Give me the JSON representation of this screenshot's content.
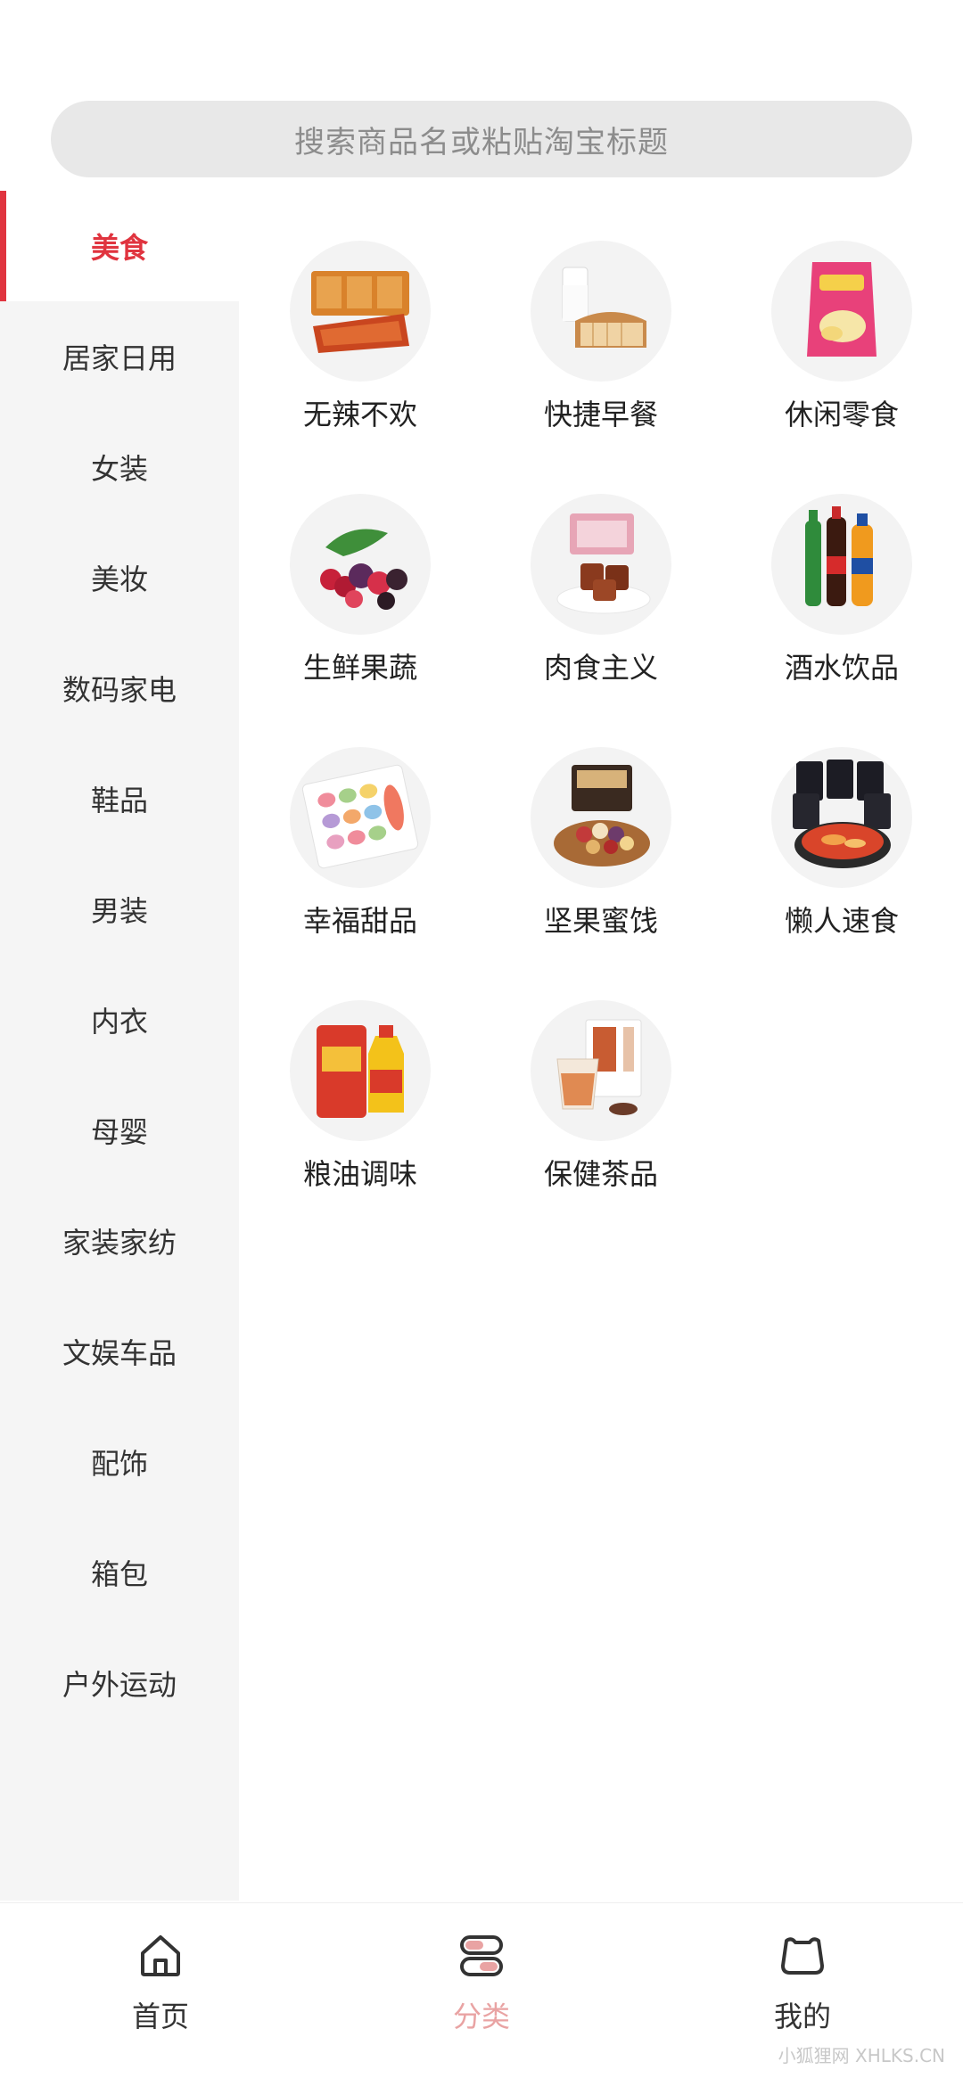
{
  "search": {
    "placeholder": "搜索商品名或粘贴淘宝标题"
  },
  "sidebar": {
    "items": [
      {
        "label": "美食",
        "active": true
      },
      {
        "label": "居家日用"
      },
      {
        "label": "女装"
      },
      {
        "label": "美妆"
      },
      {
        "label": "数码家电"
      },
      {
        "label": "鞋品"
      },
      {
        "label": "男装"
      },
      {
        "label": "内衣"
      },
      {
        "label": "母婴"
      },
      {
        "label": "家装家纺"
      },
      {
        "label": "文娱车品"
      },
      {
        "label": "配饰"
      },
      {
        "label": "箱包"
      },
      {
        "label": "户外运动"
      }
    ]
  },
  "subcategories": [
    {
      "label": "无辣不欢",
      "icon": "spicy-snack-icon"
    },
    {
      "label": "快捷早餐",
      "icon": "bread-milk-icon"
    },
    {
      "label": "休闲零食",
      "icon": "chips-bag-icon"
    },
    {
      "label": "生鲜果蔬",
      "icon": "berries-icon"
    },
    {
      "label": "肉食主义",
      "icon": "meat-box-icon"
    },
    {
      "label": "酒水饮品",
      "icon": "drink-bottles-icon"
    },
    {
      "label": "幸福甜品",
      "icon": "macaron-box-icon"
    },
    {
      "label": "坚果蜜饯",
      "icon": "nuts-bowl-icon"
    },
    {
      "label": "懒人速食",
      "icon": "instant-noodles-icon"
    },
    {
      "label": "粮油调味",
      "icon": "rice-oil-icon"
    },
    {
      "label": "保健茶品",
      "icon": "tea-cup-icon"
    }
  ],
  "tabbar": {
    "items": [
      {
        "label": "首页",
        "icon": "home-icon"
      },
      {
        "label": "分类",
        "icon": "category-icon",
        "active": true
      },
      {
        "label": "我的",
        "icon": "profile-icon"
      }
    ]
  },
  "watermark": "小狐狸网 XHLKS.CN",
  "colors": {
    "accent": "#e0343f",
    "tab_active": "#e9a3a3"
  }
}
